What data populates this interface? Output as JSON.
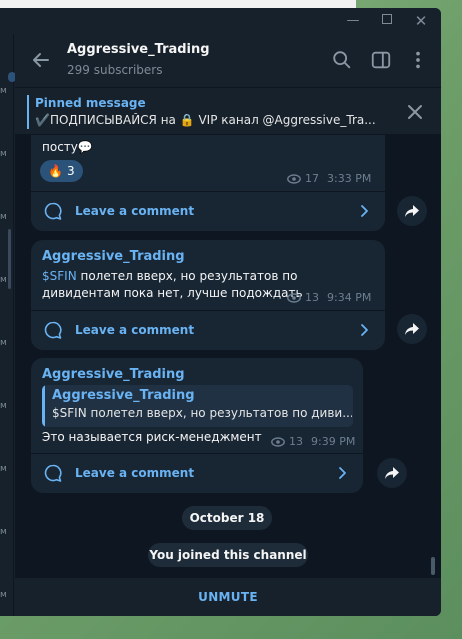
{
  "window": {
    "controls": [
      "minimize",
      "maximize",
      "close"
    ]
  },
  "header": {
    "title": "Aggressive_Trading",
    "subtitle": "299 subscribers"
  },
  "pinned": {
    "title": "Pinned message",
    "text": "✔️ПОДПИСЫВАЙСЯ на 🔒 VIP канал @Aggressive_Tra..."
  },
  "sidebar": {
    "letters": [
      "м",
      "м",
      "м",
      "м",
      "м",
      "м",
      "м",
      "м",
      "м"
    ]
  },
  "messages": [
    {
      "text": "посту💬",
      "reaction": {
        "emoji": "🔥",
        "count": "3"
      },
      "views": "17",
      "time": "3:33 PM",
      "comment_label": "Leave a comment"
    },
    {
      "author": "Aggressive_Trading",
      "tag": "$SFIN",
      "text_rest": " полетел вверх, но результатов по дивидентам пока нет, лучше подождать",
      "views": "13",
      "time": "9:34 PM",
      "comment_label": "Leave a comment"
    },
    {
      "author": "Aggressive_Trading",
      "quote_author": "Aggressive_Trading",
      "quote_text": "$SFIN полетел вверх, но результатов по диви...",
      "text": "Это называется риск-менеджмент",
      "views": "13",
      "time": "9:39 PM",
      "comment_label": "Leave a comment"
    }
  ],
  "date_pill": "October 18",
  "service_pill": "You joined this channel",
  "bottom": {
    "action": "UNMUTE"
  },
  "colors": {
    "accent": "#6ab3f3",
    "bubble": "#182533",
    "chat_bg": "#0e1621",
    "panel": "#17212b"
  }
}
